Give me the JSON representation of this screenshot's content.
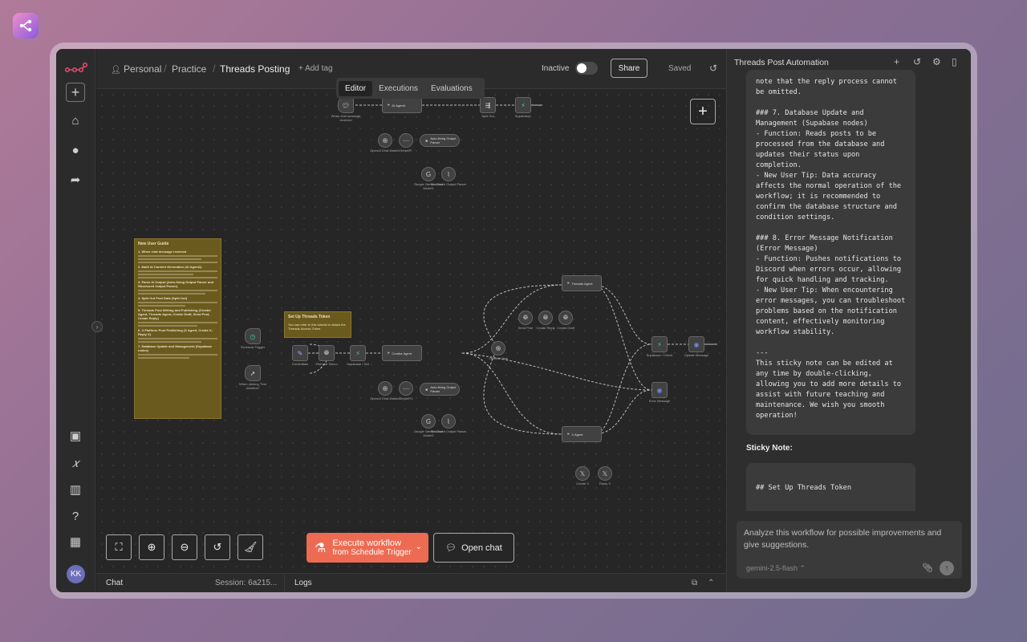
{
  "header": {
    "breadcrumb": [
      "Personal",
      "Practice",
      "Threads Posting"
    ],
    "add_tag": "+ Add tag",
    "status_label": "Inactive",
    "share_label": "Share",
    "saved_label": "Saved",
    "tabs": [
      "Editor",
      "Executions",
      "Evaluations"
    ],
    "active_tab": "Editor"
  },
  "canvas": {
    "nodes": {
      "top_trigger": "When chat message received",
      "top_agent": "AI Agent1",
      "top_split": "Split Out",
      "top_supabase": "Supabase1",
      "top_openai": "OpenAI Chat Model1",
      "top_serp": "SerpAPI",
      "top_parser": "Auto-fixing Output Parser",
      "top_gemini": "Google Gemini Chat Model1",
      "top_structured": "Structured Output Parser",
      "schedule": "Schedule Trigger",
      "when_test": "When clicking 'Test workflow'",
      "credentials": "Credentials",
      "refresh": "Refresh Token",
      "supabase_get": "Supabase / Get",
      "creator": "Creator Agent",
      "mid_openai": "OpenAI Chat Model2",
      "mid_serp": "SerpAPI1",
      "mid_parser": "Auto-fixing Output Parser",
      "mid_gemini": "Google Gemini Chat Model2",
      "mid_structured": "Structured Output Parser",
      "threads_agent": "Threads Agent",
      "send_post": "Send Post",
      "create_reply": "Create Reply",
      "create_draft": "Create Draft",
      "openai_chat": "OpenAI Chat",
      "supabase_check": "Supabase / Check",
      "discord_msg": "Update Message",
      "error_msg": "Error Message",
      "x_agent": "X Agent",
      "create_x": "Create X",
      "reply_x": "Reply X"
    },
    "sticky_guide": {
      "title": "New User Guide",
      "sections": [
        "1. When chat message received",
        "2. Multi AI Content Generation (AI Agent1)",
        "3. Parse AI Output (Auto-fixing Output Parser and Structured Output Parser)",
        "4. Split Out Post Data (Split Out)",
        "5. Threads Post Writing and Publishing (Creator Agent, Threads Agent, Create Draft, Send Post, Create Reply)",
        "6. X Platform Post Publishing (X Agent, Create X, Reply X)",
        "7. Database Update and Management (Supabase nodes)"
      ]
    },
    "sticky_token": {
      "title": "Set Up Threads Token",
      "text": "You can refer to this tutorial to obtain the Threads Access Token."
    },
    "execute_label": "Execute workflow",
    "execute_sub": "from Schedule Trigger",
    "open_chat_label": "Open chat"
  },
  "bottom": {
    "chat_label": "Chat",
    "session_label": "Session: 6a215...",
    "logs_label": "Logs"
  },
  "panel": {
    "title": "Threads Post Automation",
    "message": "note that the reply process cannot\nbe omitted.\n\n### 7. Database Update and\nManagement (Supabase nodes)\n- Function: Reads posts to be\nprocessed from the database and\nupdates their status upon\ncompletion.\n- New User Tip: Data accuracy\naffects the normal operation of the\nworkflow; it is recommended to\nconfirm the database structure and\ncondition settings.\n\n### 8. Error Message Notification\n(Error Message)\n- Function: Pushes notifications to\nDiscord when errors occur, allowing\nfor quick handling and tracking.\n- New User Tip: When encountering\nerror messages, you can troubleshoot\nproblems based on the notification\ncontent, effectively monitoring\nworkflow stability.\n\n---\nThis sticky note can be edited at\nany time by double-clicking,\nallowing you to add more details to\nassist with future teaching and\nmaintenance. We wish you smooth\noperation!",
    "sticky_heading": "Sticky Note:",
    "message2": "## Set Up Threads Token",
    "input_value": "Analyze this workflow for possible improvements and give suggestions.",
    "model": "gemini-2.5-flash"
  },
  "user": {
    "initials": "KK"
  },
  "colors": {
    "accent": "#ee6b53",
    "sticky": "#6b5a1e",
    "brand": "#ea4b71"
  }
}
